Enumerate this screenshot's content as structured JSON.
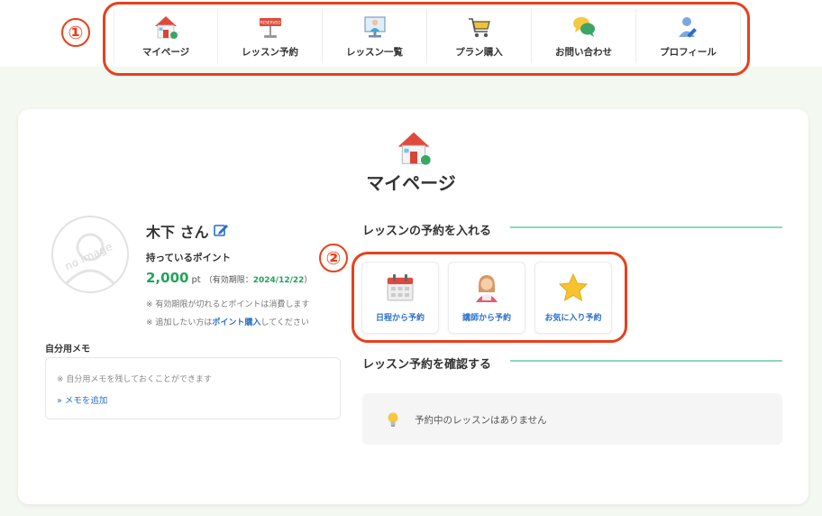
{
  "annotations": {
    "one": "①",
    "two": "②"
  },
  "nav": {
    "items": [
      {
        "label": "マイページ",
        "icon": "home-icon"
      },
      {
        "label": "レッスン予約",
        "icon": "reserved-sign-icon"
      },
      {
        "label": "レッスン一覧",
        "icon": "teacher-monitor-icon"
      },
      {
        "label": "プラン購入",
        "icon": "cart-icon"
      },
      {
        "label": "お問い合わせ",
        "icon": "chat-bubbles-icon"
      },
      {
        "label": "プロフィール",
        "icon": "profile-edit-icon"
      }
    ],
    "reserved_sign_text": "RESERVED"
  },
  "page": {
    "title": "マイページ"
  },
  "user": {
    "name": "木下 さん",
    "avatar_text": "no image",
    "points_label": "持っているポイント",
    "points_value": "2,000",
    "points_unit": "pt",
    "expiry_prefix": "（有効期限：",
    "expiry_date": "2024/12/22",
    "expiry_suffix": "）",
    "note1": "※ 有効期限が切れるとポイントは消費します",
    "note2_prefix": "※ 追加したい方は",
    "note2_link": "ポイント購入",
    "note2_suffix": "してください"
  },
  "memo": {
    "label": "自分用メモ",
    "placeholder": "※ 自分用メモを残しておくことができます",
    "add_link": "» メモを追加"
  },
  "reservation": {
    "heading": "レッスンの予約を入れる",
    "buttons": [
      {
        "label": "日程から予約",
        "icon": "calendar-icon"
      },
      {
        "label": "講師から予約",
        "icon": "teacher-icon"
      },
      {
        "label": "お気に入り予約",
        "icon": "star-icon"
      }
    ]
  },
  "confirm": {
    "heading": "レッスン予約を確認する",
    "empty_text": "予約中のレッスンはありません"
  },
  "colors": {
    "accent_green": "#24a35a",
    "link_blue": "#2a6fc9",
    "annotation_red": "#e8401c",
    "section_line": "#8fd6bd"
  }
}
